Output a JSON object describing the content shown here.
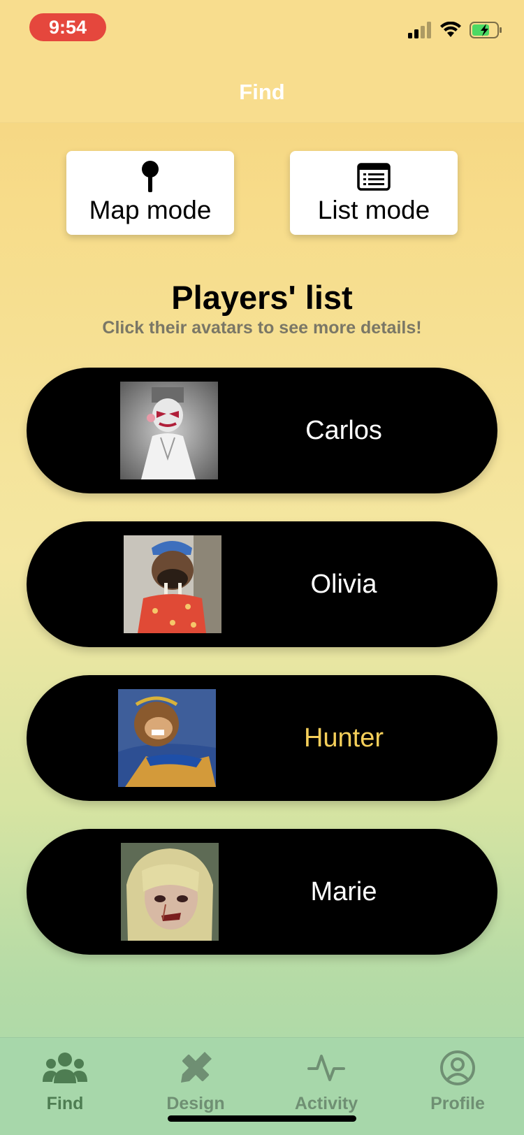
{
  "status_bar": {
    "time": "9:54"
  },
  "header": {
    "title": "Find"
  },
  "modes": {
    "map_label": "Map mode",
    "list_label": "List mode"
  },
  "section": {
    "title": "Players' list",
    "subtitle": "Click their avatars to see more details!"
  },
  "players": [
    {
      "name": "Carlos",
      "name_color": "#ffffff"
    },
    {
      "name": "Olivia",
      "name_color": "#ffffff"
    },
    {
      "name": "Hunter",
      "name_color": "#f5cf5a"
    },
    {
      "name": "Marie",
      "name_color": "#ffffff"
    }
  ],
  "tabs": [
    {
      "label": "Find",
      "icon": "users-icon",
      "active": true
    },
    {
      "label": "Design",
      "icon": "pencil-ruler-icon",
      "active": false
    },
    {
      "label": "Activity",
      "icon": "activity-icon",
      "active": false
    },
    {
      "label": "Profile",
      "icon": "user-circle-icon",
      "active": false
    }
  ],
  "colors": {
    "tab_active": "#4e7d52",
    "tab_inactive": "#6f8f73",
    "time_pill": "#e5473d"
  }
}
